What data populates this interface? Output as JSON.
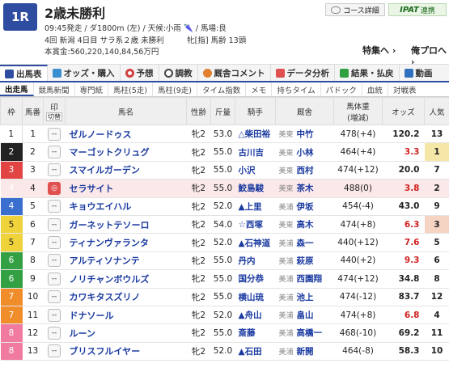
{
  "header": {
    "race_number": "1R",
    "race_name": "2歳未勝利",
    "info_line1": "09:45発走 / ダ1800m (左) / 天候:小雨 🌂 / 馬場:良",
    "info_line2": "4回 新潟 4日目 サラ系２歳 未勝利　　　牝[指] 馬齢 13頭",
    "info_line3": "本賞金:560,220,140,84,56万円",
    "course_btn": "コース詳細",
    "ipat_btn": "IPAT",
    "ipat_sub": "連携",
    "link_tokushu": "特集へ ›",
    "link_ore": "俺プロへ ›"
  },
  "tabs_main": [
    {
      "label": "出馬表",
      "icon": "table-icon",
      "color": "#2f4da0"
    },
    {
      "label": "オッズ・購入",
      "icon": "odds-icon",
      "color": "#3a8fd0"
    },
    {
      "label": "予想",
      "icon": "target-icon",
      "color": "#d04040"
    },
    {
      "label": "調教",
      "icon": "stopwatch-icon",
      "color": "#444444"
    },
    {
      "label": "厩舎コメント",
      "icon": "comment-icon",
      "color": "#e08030"
    },
    {
      "label": "データ分析",
      "icon": "chart-icon",
      "color": "#e05050"
    },
    {
      "label": "結果・払戻",
      "icon": "result-icon",
      "color": "#30a040"
    },
    {
      "label": "動画",
      "icon": "video-icon",
      "color": "#3070c0"
    }
  ],
  "tabs_sub": [
    "出走馬",
    "競馬新聞",
    "専門紙",
    "馬柱(5走)",
    "馬柱(9走)",
    "タイム指数",
    "メモ",
    "持ちタイム",
    "パドック",
    "血統",
    "対戦表"
  ],
  "table_headers": {
    "waku": "枠",
    "umaban": "馬番",
    "mark": "印",
    "mark2": "切替",
    "horse": "馬名",
    "sex_age": "性齢",
    "weight": "斤量",
    "jockey": "騎手",
    "trainer": "厩舎",
    "body_weight": "馬体重",
    "body_weight2": "(増減)",
    "odds": "オッズ",
    "pop": "人気"
  },
  "rows": [
    {
      "waku": "1",
      "umaban": "1",
      "horse": "ゼルノードゥス",
      "sex_age": "牝2",
      "weight": "53.0",
      "jockey": "△柴田裕",
      "region": "美東",
      "trainer": "中竹",
      "body": "478(+4)",
      "odds": "120.2",
      "pop": "13"
    },
    {
      "waku": "2",
      "umaban": "2",
      "horse": "マーゴットクリュグ",
      "sex_age": "牝2",
      "weight": "55.0",
      "jockey": "古川吉",
      "region": "美東",
      "trainer": "小林",
      "body": "464(+4)",
      "odds": "3.3",
      "pop": "1"
    },
    {
      "waku": "3",
      "umaban": "3",
      "horse": "スマイルガーデン",
      "sex_age": "牝2",
      "weight": "55.0",
      "jockey": "小沢",
      "region": "美東",
      "trainer": "西村",
      "body": "474(+12)",
      "odds": "20.0",
      "pop": "7"
    },
    {
      "waku": "4",
      "umaban": "4",
      "horse": "セラサイト",
      "sex_age": "牝2",
      "weight": "55.0",
      "jockey": "鮫島駿",
      "region": "美東",
      "trainer": "茶木",
      "body": "488(0)",
      "odds": "3.8",
      "pop": "2"
    },
    {
      "waku": "4",
      "umaban": "5",
      "horse": "キョウエイハル",
      "sex_age": "牝2",
      "weight": "52.0",
      "jockey": "▲上里",
      "region": "美浦",
      "trainer": "伊坂",
      "body": "454(-4)",
      "odds": "43.0",
      "pop": "9"
    },
    {
      "waku": "5",
      "umaban": "6",
      "horse": "ガーネットテソーロ",
      "sex_age": "牝2",
      "weight": "54.0",
      "jockey": "☆西塚",
      "region": "美東",
      "trainer": "高木",
      "body": "474(+8)",
      "odds": "6.3",
      "pop": "3"
    },
    {
      "waku": "5",
      "umaban": "7",
      "horse": "ティナンヴァランタ",
      "sex_age": "牝2",
      "weight": "52.0",
      "jockey": "▲石神道",
      "region": "美浦",
      "trainer": "森一",
      "body": "440(+12)",
      "odds": "7.6",
      "pop": "5"
    },
    {
      "waku": "6",
      "umaban": "8",
      "horse": "アルティソナンテ",
      "sex_age": "牝2",
      "weight": "55.0",
      "jockey": "丹内",
      "region": "美浦",
      "trainer": "萩原",
      "body": "440(+2)",
      "odds": "9.3",
      "pop": "6"
    },
    {
      "waku": "6",
      "umaban": "9",
      "horse": "ノリチャンボウルズ",
      "sex_age": "牝2",
      "weight": "55.0",
      "jockey": "国分恭",
      "region": "美浦",
      "trainer": "西園翔",
      "body": "474(+12)",
      "odds": "34.8",
      "pop": "8"
    },
    {
      "waku": "7",
      "umaban": "10",
      "horse": "カワキタスズリノ",
      "sex_age": "牝2",
      "weight": "55.0",
      "jockey": "横山琉",
      "region": "美浦",
      "trainer": "池上",
      "body": "474(-12)",
      "odds": "83.7",
      "pop": "12"
    },
    {
      "waku": "7",
      "umaban": "11",
      "horse": "ドナソール",
      "sex_age": "牝2",
      "weight": "52.0",
      "jockey": "▲舟山",
      "region": "美浦",
      "trainer": "畠山",
      "body": "474(+8)",
      "odds": "6.8",
      "pop": "4"
    },
    {
      "waku": "8",
      "umaban": "12",
      "horse": "ルーン",
      "sex_age": "牝2",
      "weight": "55.0",
      "jockey": "斎藤",
      "region": "美浦",
      "trainer": "高橋一",
      "body": "468(-10)",
      "odds": "69.2",
      "pop": "11"
    },
    {
      "waku": "8",
      "umaban": "13",
      "horse": "ブリスフルイヤー",
      "sex_age": "牝2",
      "weight": "52.0",
      "jockey": "▲石田",
      "region": "美浦",
      "trainer": "新開",
      "body": "464(-8)",
      "odds": "58.3",
      "pop": "10"
    }
  ]
}
